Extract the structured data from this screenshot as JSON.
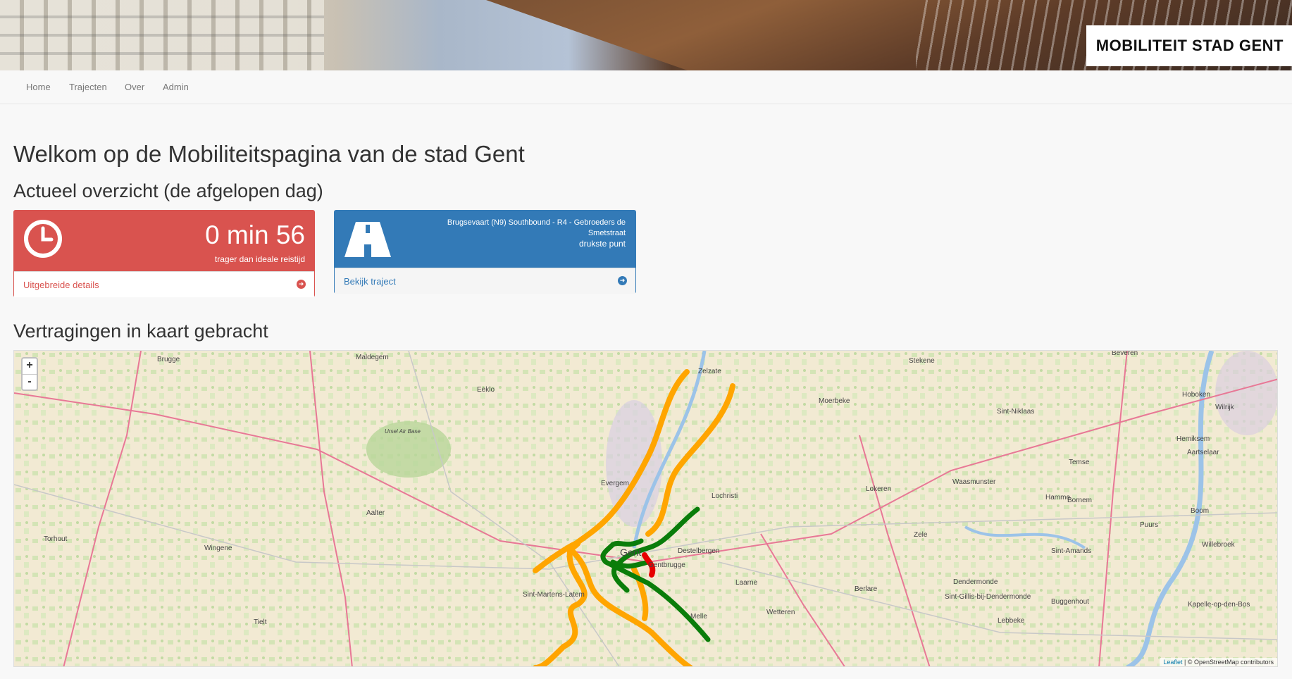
{
  "header": {
    "brand": "MOBILITEIT STAD GENT"
  },
  "nav": {
    "items": [
      "Home",
      "Trajecten",
      "Over",
      "Admin"
    ]
  },
  "page_title": "Welkom op de Mobiliteitspagina van de stad Gent",
  "overview": {
    "heading": "Actueel overzicht (de afgelopen dag)",
    "delay_card": {
      "value": "0 min 56",
      "caption": "trager dan ideale reistijd",
      "link": "Uitgebreide details",
      "icon": "clock-icon",
      "color": "#d9534f"
    },
    "route_card": {
      "route": "Brugsevaart (N9) Southbound - R4 - Gebroeders de Smetstraat",
      "caption": "drukste punt",
      "link": "Bekijk traject",
      "icon": "road-icon",
      "color": "#337ab7"
    }
  },
  "map_section": {
    "heading": "Vertragingen in kaart gebracht",
    "zoom_in": "+",
    "zoom_out": "-",
    "attribution_leaflet": "Leaflet",
    "attribution_osm": "| © OpenStreetMap contributors",
    "towns": [
      "Brugge",
      "Maldegem",
      "Eeklo",
      "Zelzate",
      "Stekene",
      "Beveren",
      "Moerbeke",
      "Sint-Niklaas",
      "Hoboken",
      "Wilrijk",
      "Hemiksem",
      "Aartselaar",
      "Temse",
      "Bornem",
      "Boom",
      "Evergem",
      "Lochristi",
      "Lokeren",
      "Waasmunster",
      "Hamme",
      "Puurs",
      "Aalter",
      "Torhout",
      "Wingene",
      "Gent",
      "Destelbergen",
      "Gentbrugge",
      "Laarne",
      "Zele",
      "Sint-Amands",
      "Willebroek",
      "Berlare",
      "Dendermonde",
      "Sint-Gillis-bij-Dendermonde",
      "Buggenhout",
      "Kapelle-op-den-Bos",
      "Sint-Martens-Latem",
      "Wetteren",
      "Melle",
      "Lebbeke",
      "Tielt",
      "Ursel Air Base"
    ],
    "road_colors": {
      "fast": "#0a7d0a",
      "slow": "#ffa500",
      "jam": "#e60000"
    }
  }
}
